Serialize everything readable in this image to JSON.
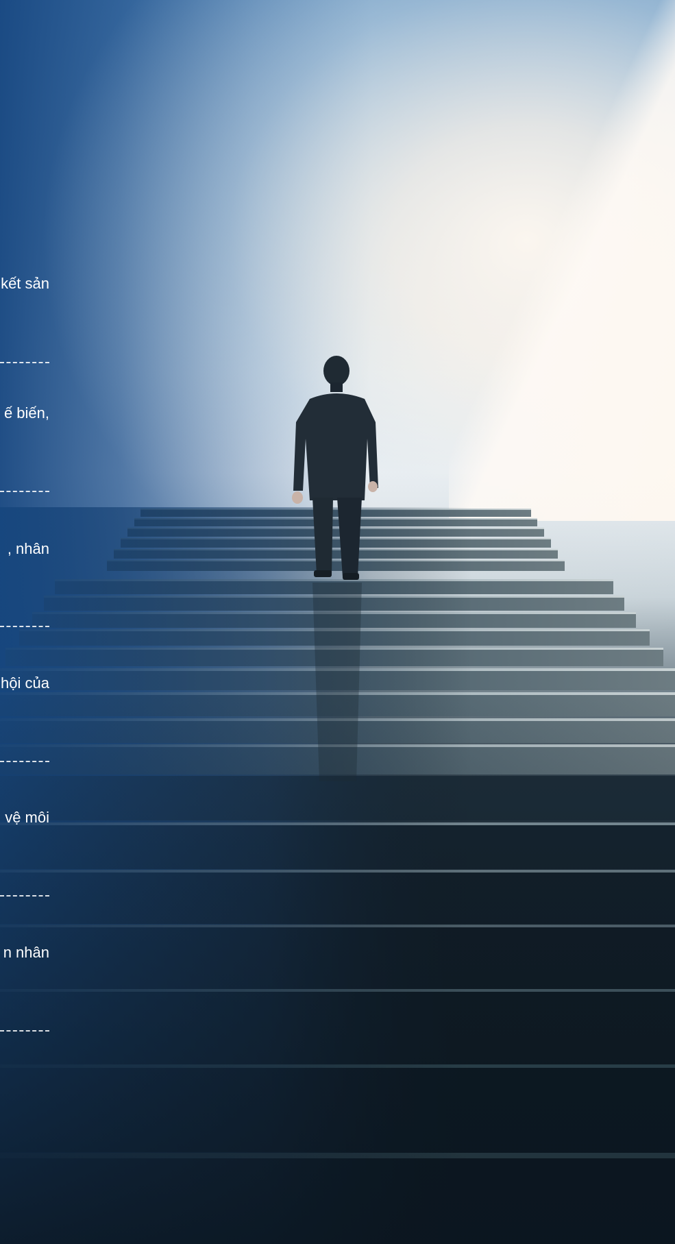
{
  "items": [
    {
      "text": "kết sản"
    },
    {
      "text": "ế biến,"
    },
    {
      "text": ", nhân"
    },
    {
      "text": "hội của"
    },
    {
      "text": "vệ môi"
    },
    {
      "text": "n nhân"
    }
  ]
}
